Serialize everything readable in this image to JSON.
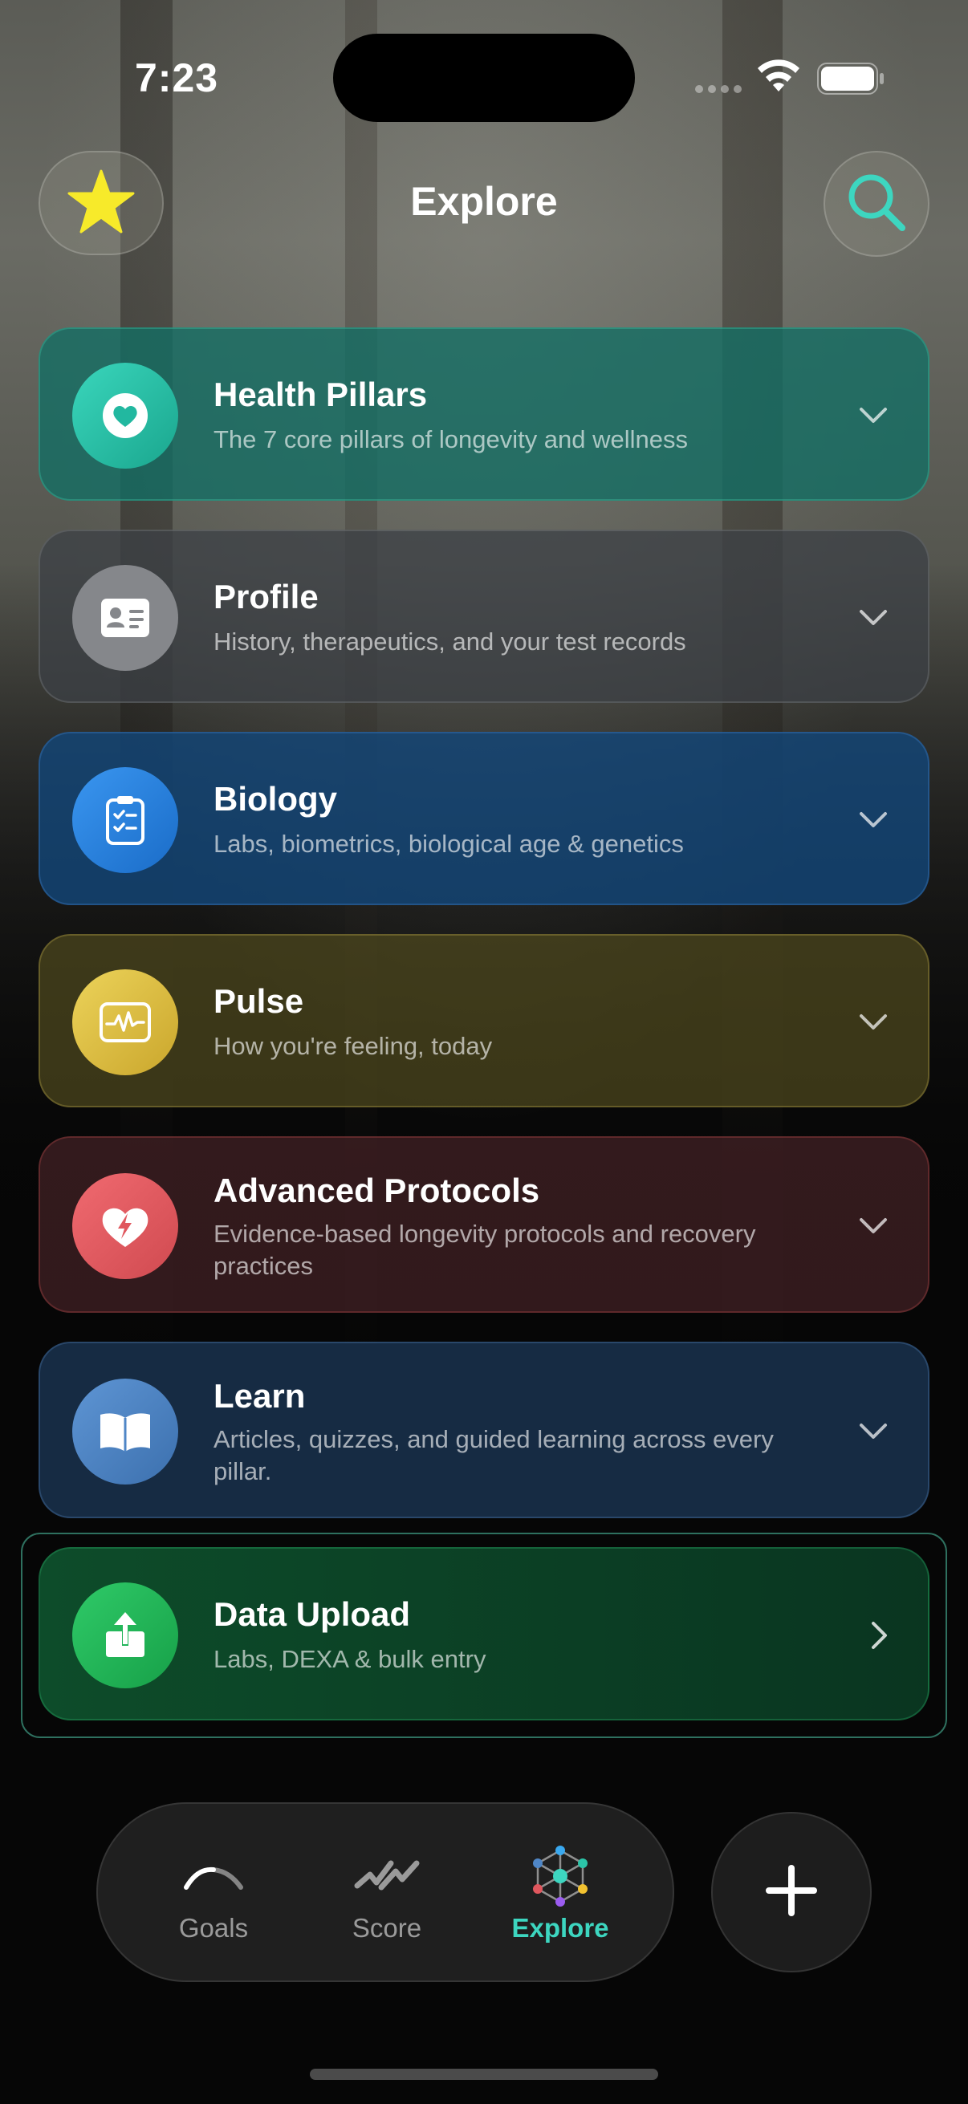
{
  "status": {
    "time": "7:23"
  },
  "header": {
    "title": "Explore"
  },
  "cards": [
    {
      "title": "Health Pillars",
      "subtitle": "The 7 core pillars of longevity and wellness",
      "icon": "heart-icon",
      "color": "#2bc4a8"
    },
    {
      "title": "Profile",
      "subtitle": "History, therapeutics, and your test records",
      "icon": "id-card-icon",
      "color": "#8a8c90"
    },
    {
      "title": "Biology",
      "subtitle": "Labs, biometrics, biological age & genetics",
      "icon": "clipboard-icon",
      "color": "#2f86e0"
    },
    {
      "title": "Pulse",
      "subtitle": "How you're feeling, today",
      "icon": "pulse-monitor-icon",
      "color": "#d9b93c"
    },
    {
      "title": "Advanced Protocols",
      "subtitle": "Evidence-based longevity protocols and recovery practices",
      "icon": "heart-bolt-icon",
      "color": "#e0575e"
    },
    {
      "title": "Learn",
      "subtitle": "Articles, quizzes, and guided learning across every pillar.",
      "icon": "book-icon",
      "color": "#4f86c6"
    },
    {
      "title": "Data Upload",
      "subtitle": "Labs, DEXA & bulk entry",
      "icon": "upload-icon",
      "color": "#22b45a"
    }
  ],
  "tabbar": {
    "tabs": [
      {
        "label": "Goals",
        "icon": "gauge-icon"
      },
      {
        "label": "Score",
        "icon": "score-check-icon"
      },
      {
        "label": "Explore",
        "icon": "explore-network-icon",
        "active": true
      }
    ],
    "accent": "#3dd6c0"
  }
}
